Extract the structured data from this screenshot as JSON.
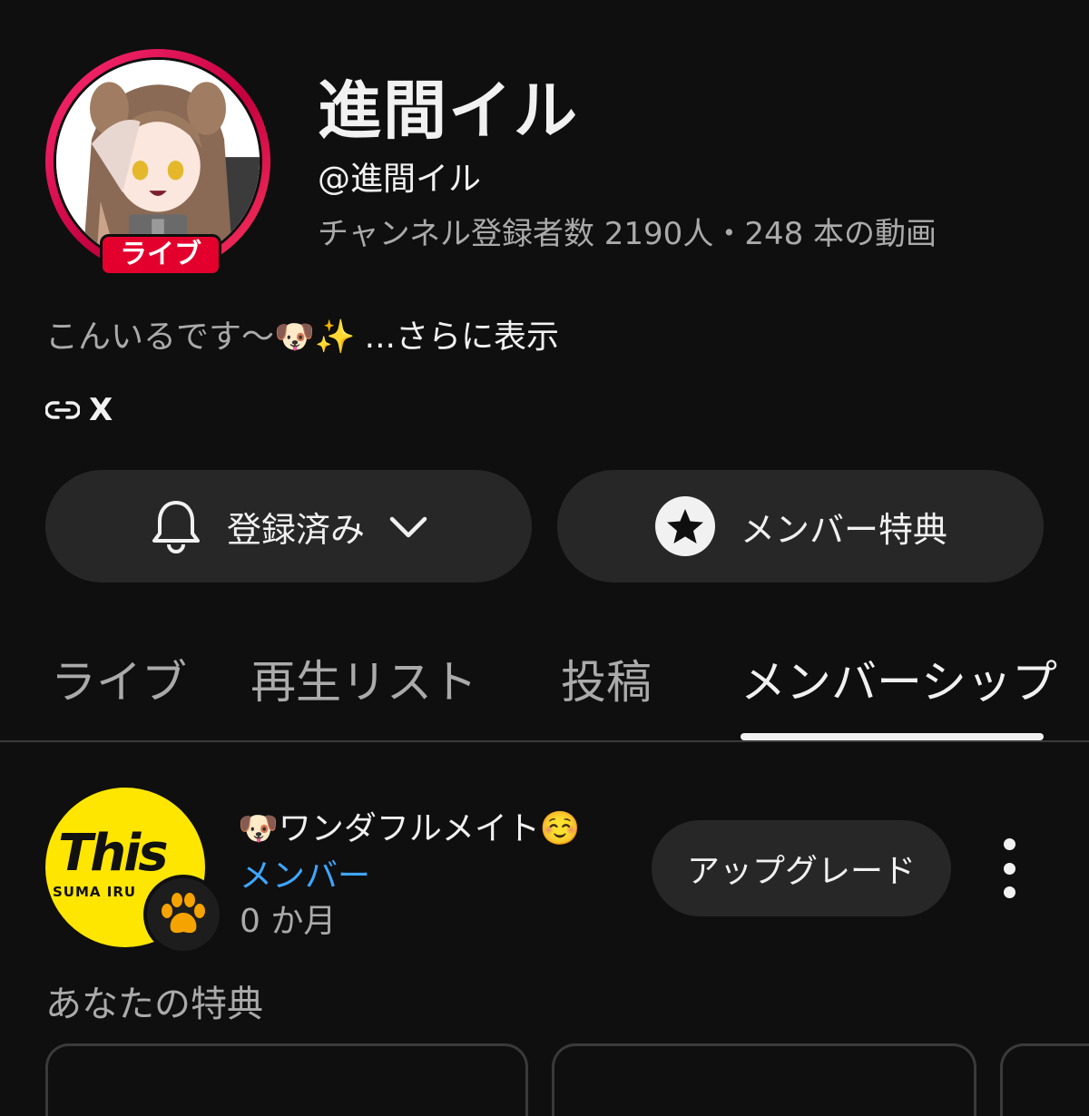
{
  "channel": {
    "name": "進間イル",
    "handle": "@進間イル",
    "stats": "チャンネル登録者数 2190人・248 本の動画",
    "live_badge": "ライブ",
    "description": "こんいるです〜🐶✨",
    "description_more": "...さらに表示",
    "link_label": "X"
  },
  "actions": {
    "subscribed_label": "登録済み",
    "member_label": "メンバー特典"
  },
  "tabs": [
    {
      "label": "ライブ",
      "active": false
    },
    {
      "label": "再生リスト",
      "active": false
    },
    {
      "label": "投稿",
      "active": false
    },
    {
      "label": "メンバーシップ",
      "active": true
    }
  ],
  "membership": {
    "logo_text": "This",
    "logo_subtext": "SUMA IRU",
    "tier_name": "🐶ワンダフルメイト☺️",
    "status": "メンバー",
    "duration": "0 か月",
    "upgrade_label": "アップグレード",
    "perks_heading": "あなたの特典"
  },
  "colors": {
    "background": "#0f0f0f",
    "surface": "#272727",
    "text_primary": "#f1f1f1",
    "text_secondary": "#aaaaaa",
    "accent_blue": "#3ea6ff",
    "live_red": "#e3002d",
    "logo_yellow": "#ffe600"
  }
}
